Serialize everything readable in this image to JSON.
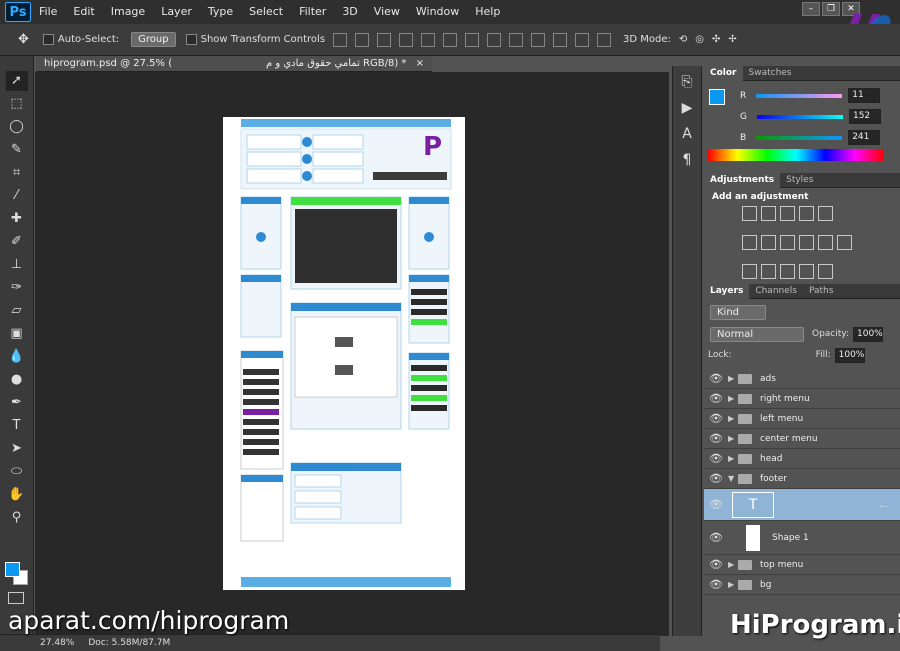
{
  "app": {
    "logo": "Ps"
  },
  "menu": [
    "File",
    "Edit",
    "Image",
    "Layer",
    "Type",
    "Select",
    "Filter",
    "3D",
    "View",
    "Window",
    "Help"
  ],
  "options": {
    "auto_select_label": "Auto-Select:",
    "auto_select_value": "Group",
    "transform_label": "Show Transform Controls",
    "mode_3d": "3D Mode:"
  },
  "document": {
    "tab_title": "hiprogram.psd @ 27.5% (",
    "tab_suffix": "تمامي حقوق مادي و م RGB/8) *",
    "close": "×"
  },
  "status": {
    "zoom": "27.48%",
    "doc": "Doc: 5.58M/87.7M"
  },
  "watermarks": {
    "left": "aparat.com/hiprogram",
    "right": "HiProgram.ir"
  },
  "color_panel": {
    "tabs": [
      "Color",
      "Swatches"
    ],
    "r": "11",
    "g": "152",
    "b": "241",
    "r_label": "R",
    "g_label": "G",
    "b_label": "B",
    "fg": "#0b98f1"
  },
  "adjustments": {
    "tabs": [
      "Adjustments",
      "Styles"
    ],
    "title": "Add an adjustment"
  },
  "layers_panel": {
    "tabs": [
      "Layers",
      "Channels",
      "Paths"
    ],
    "filter": "Kind",
    "blend": "Normal",
    "opacity_label": "Opacity:",
    "opacity": "100%",
    "lock_label": "Lock:",
    "fill_label": "Fill:",
    "fill": "100%",
    "layers": [
      {
        "name": "ads",
        "type": "folder"
      },
      {
        "name": "right menu",
        "type": "folder"
      },
      {
        "name": "left menu",
        "type": "folder"
      },
      {
        "name": "center menu",
        "type": "folder"
      },
      {
        "name": "head",
        "type": "folder"
      },
      {
        "name": "footer",
        "type": "folder-open"
      },
      {
        "name": "",
        "type": "text",
        "more": "..."
      },
      {
        "name": "Shape 1",
        "type": "shape"
      },
      {
        "name": "top menu",
        "type": "folder"
      },
      {
        "name": "bg",
        "type": "folder"
      }
    ]
  }
}
